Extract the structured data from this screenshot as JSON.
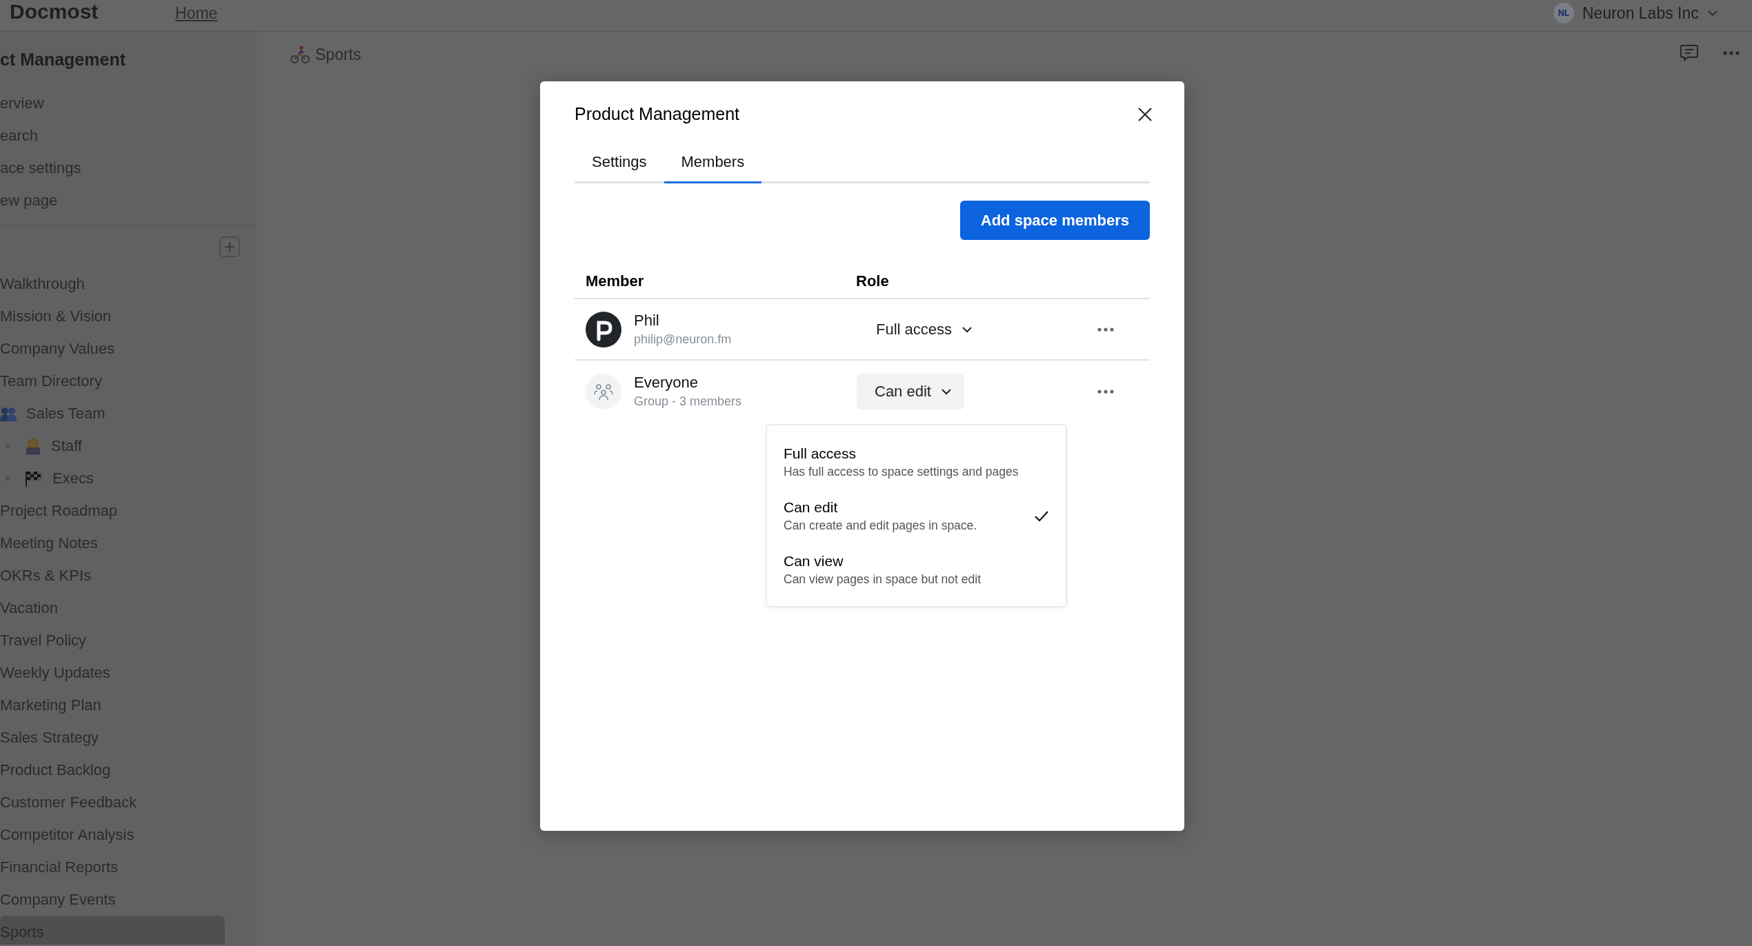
{
  "header": {
    "logo": "Docmost",
    "nav": [
      {
        "label": "Home"
      }
    ],
    "workspace": {
      "initials": "NL",
      "name": "Neuron Labs Inc"
    }
  },
  "sidebar": {
    "space_title": "ct Management",
    "menu": [
      "erview",
      "earch",
      "ace settings",
      "ew page"
    ],
    "pages": [
      {
        "label": "Walkthrough",
        "kind": "page",
        "selected": false
      },
      {
        "label": "Mission & Vision",
        "kind": "page",
        "selected": false
      },
      {
        "label": "Company Values",
        "kind": "page",
        "selected": false
      },
      {
        "label": "Team Directory",
        "kind": "page",
        "selected": false
      },
      {
        "label": "Sales Team",
        "kind": "icon_page",
        "selected": false,
        "children": [
          {
            "label": "Staff",
            "kind": "icon_page",
            "selected": false
          },
          {
            "label": "Execs",
            "kind": "icon_page",
            "selected": false
          }
        ]
      },
      {
        "label": "Project Roadmap",
        "kind": "page",
        "selected": false
      },
      {
        "label": "Meeting Notes",
        "kind": "page",
        "selected": false
      },
      {
        "label": "OKRs & KPIs",
        "kind": "page",
        "selected": false
      },
      {
        "label": "Vacation",
        "kind": "page",
        "selected": false
      },
      {
        "label": "Travel Policy",
        "kind": "page",
        "selected": false
      },
      {
        "label": "Weekly Updates",
        "kind": "page",
        "selected": false
      },
      {
        "label": "Marketing Plan",
        "kind": "page",
        "selected": false
      },
      {
        "label": "Sales Strategy",
        "kind": "page",
        "selected": false
      },
      {
        "label": "Product Backlog",
        "kind": "page",
        "selected": false
      },
      {
        "label": "Customer Feedback",
        "kind": "page",
        "selected": false
      },
      {
        "label": "Competitor Analysis",
        "kind": "page",
        "selected": false
      },
      {
        "label": "Financial Reports",
        "kind": "page",
        "selected": false
      },
      {
        "label": "Company Events",
        "kind": "page",
        "selected": false
      },
      {
        "label": "Sports",
        "kind": "page",
        "selected": true
      }
    ]
  },
  "breadcrumb": "Sports",
  "dialog": {
    "title": "Product Management",
    "tabs": [
      {
        "label": "Settings",
        "selected": false
      },
      {
        "label": "Members",
        "selected": true
      }
    ],
    "add_button": "Add space members",
    "table": {
      "columns": [
        "Member",
        "Role"
      ],
      "rows": [
        {
          "kind": "user",
          "name": "Phil",
          "detail": "philip@neuron.fm",
          "role": "Full access",
          "menu_open": false
        },
        {
          "kind": "group",
          "name": "Everyone",
          "detail": "Group - 3 members",
          "role": "Can edit",
          "menu_open": true
        }
      ]
    },
    "role_menu": [
      {
        "label": "Full access",
        "description": "Has full access to space settings and pages",
        "selected": false
      },
      {
        "label": "Can edit",
        "description": "Can create and edit pages in space.",
        "selected": true
      },
      {
        "label": "Can view",
        "description": "Can view pages in space but not edit",
        "selected": false
      }
    ]
  }
}
